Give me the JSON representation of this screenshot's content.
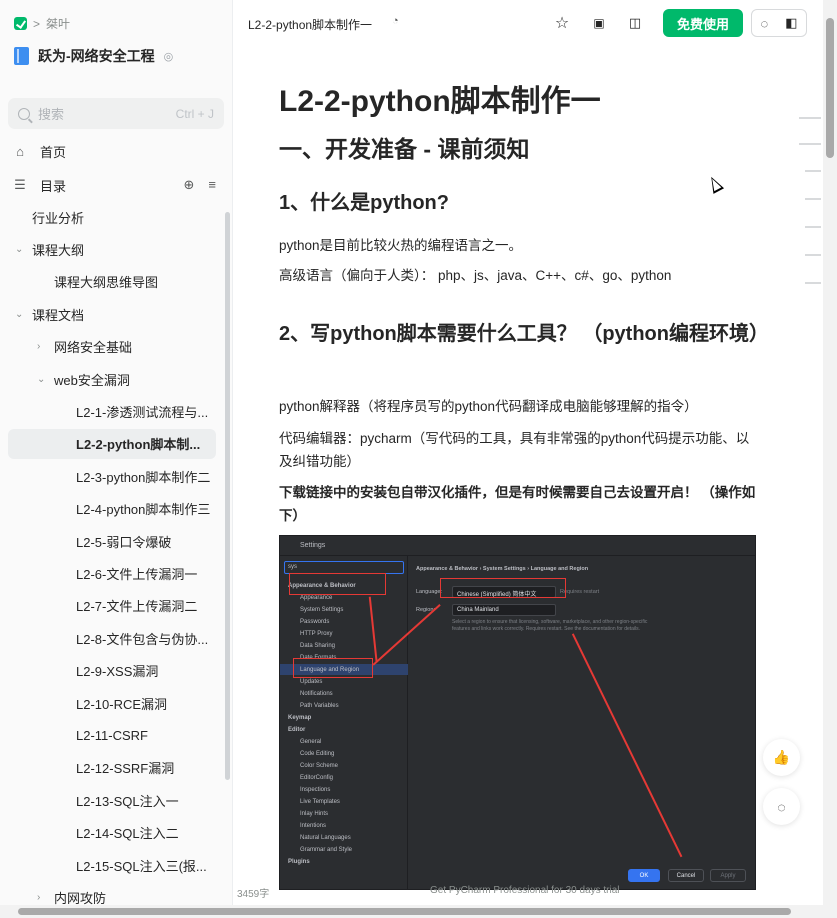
{
  "breadcrumb": {
    "separator": ">",
    "label": "桀叶"
  },
  "book": {
    "title": "跃为-网络安全工程"
  },
  "search": {
    "placeholder": "搜索",
    "shortcut": "Ctrl + J"
  },
  "nav": {
    "home": "首页",
    "toc": "目录"
  },
  "tree": [
    {
      "label": "行业分析",
      "level": 0,
      "caret": ""
    },
    {
      "label": "课程大纲",
      "level": 0,
      "caret": "v"
    },
    {
      "label": "课程大纲思维导图",
      "level": 1,
      "caret": ""
    },
    {
      "label": "课程文档",
      "level": 0,
      "caret": "v"
    },
    {
      "label": "网络安全基础",
      "level": 1,
      "caret": ">"
    },
    {
      "label": "web安全漏洞",
      "level": 1,
      "caret": "v"
    },
    {
      "label": "L2-1-渗透测试流程与...",
      "level": 2,
      "caret": ""
    },
    {
      "label": "L2-2-python脚本制...",
      "level": 2,
      "caret": "",
      "active": true
    },
    {
      "label": "L2-3-python脚本制作二",
      "level": 2,
      "caret": ""
    },
    {
      "label": "L2-4-python脚本制作三",
      "level": 2,
      "caret": ""
    },
    {
      "label": "L2-5-弱口令爆破",
      "level": 2,
      "caret": ""
    },
    {
      "label": "L2-6-文件上传漏洞一",
      "level": 2,
      "caret": ""
    },
    {
      "label": "L2-7-文件上传漏洞二",
      "level": 2,
      "caret": ""
    },
    {
      "label": "L2-8-文件包含与伪协...",
      "level": 2,
      "caret": ""
    },
    {
      "label": "L2-9-XSS漏洞",
      "level": 2,
      "caret": ""
    },
    {
      "label": "L2-10-RCE漏洞",
      "level": 2,
      "caret": ""
    },
    {
      "label": "L2-11-CSRF",
      "level": 2,
      "caret": ""
    },
    {
      "label": "L2-12-SSRF漏洞",
      "level": 2,
      "caret": ""
    },
    {
      "label": "L2-13-SQL注入一",
      "level": 2,
      "caret": ""
    },
    {
      "label": "L2-14-SQL注入二",
      "level": 2,
      "caret": ""
    },
    {
      "label": "L2-15-SQL注入三(报...",
      "level": 2,
      "caret": ""
    },
    {
      "label": "内网攻防",
      "level": 1,
      "caret": ">"
    }
  ],
  "header": {
    "doc_tab": "L2-2-python脚本制作一",
    "cta": "免费使用"
  },
  "doc": {
    "title": "L2-2-python脚本制作一",
    "section": "一、开发准备 - 课前须知",
    "h_q1": "1、什么是python?",
    "p1": "python是目前比较火热的编程语言之一。",
    "p2": "高级语言（偏向于人类）： php、js、java、C++、c#、go、python",
    "h_q2": "2、写python脚本需要什么工具？ （python编程环境）",
    "p3": "python解释器（将程序员写的python代码翻译成电脑能够理解的指令）",
    "p4": "代码编辑器：pycharm（写代码的工具，具有非常强的python代码提示功能、以及纠错功能）",
    "p5": "下载链接中的安装包自带汉化插件，但是有时候需要自己去设置开启！ （操作如下）"
  },
  "screenshot": {
    "window_title": "Settings",
    "search_value": "sys",
    "breadcrumb": "Appearance & Behavior  ›  System Settings  ›  Language and Region",
    "tree": [
      {
        "label": "Appearance & Behavior",
        "bold": true
      },
      {
        "label": "Appearance",
        "bold": false
      },
      {
        "label": "System Settings",
        "bold": false
      },
      {
        "label": "Passwords",
        "bold": false
      },
      {
        "label": "HTTP Proxy",
        "bold": false
      },
      {
        "label": "Data Sharing",
        "bold": false
      },
      {
        "label": "Date Formats",
        "bold": false
      },
      {
        "label": "Language and Region",
        "bold": false
      },
      {
        "label": "Updates",
        "bold": false
      },
      {
        "label": "Notifications",
        "bold": false
      },
      {
        "label": "Path Variables",
        "bold": false
      },
      {
        "label": "Keymap",
        "bold": true
      },
      {
        "label": "Editor",
        "bold": true
      },
      {
        "label": "General",
        "bold": false
      },
      {
        "label": "Code Editing",
        "bold": false
      },
      {
        "label": "Color Scheme",
        "bold": false
      },
      {
        "label": "EditorConfig",
        "bold": false
      },
      {
        "label": "Inspections",
        "bold": false
      },
      {
        "label": "Live Templates",
        "bold": false
      },
      {
        "label": "Inlay Hints",
        "bold": false
      },
      {
        "label": "Intentions",
        "bold": false
      },
      {
        "label": "Natural Languages",
        "bold": false
      },
      {
        "label": "Grammar and Style",
        "bold": false
      },
      {
        "label": "Plugins",
        "bold": true
      }
    ],
    "language_label": "Language:",
    "language_value": "Chinese (Simplified) 简体中文",
    "restart_note": "Requires restart",
    "region_label": "Region:",
    "region_value": "China Mainland",
    "hint": "Select a region to ensure that licensing, software, marketplace, and other region-specific features and links work correctly. Requires restart. See the documentation for details.",
    "ok": "OK",
    "cancel": "Cancel",
    "apply": "Apply"
  },
  "footer": {
    "word_count": "3459字",
    "caption": "Get PyCharm Professional for 30 days trial"
  }
}
